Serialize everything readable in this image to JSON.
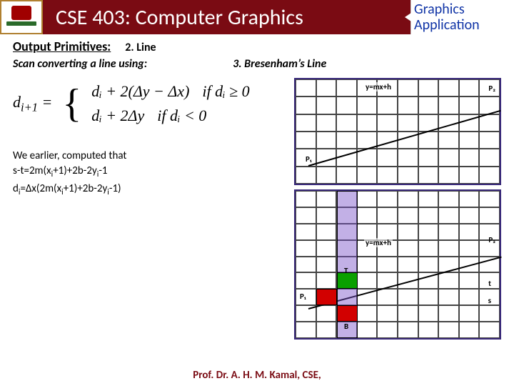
{
  "header": {
    "course": "CSE 403: Computer Graphics",
    "corner_line1": "Graphics",
    "corner_line2": "Application"
  },
  "topline": {
    "label": "Output Primitives:",
    "sub": "2. Line"
  },
  "scanline": {
    "scan": "Scan converting a line using:",
    "algo": "3. Bresenham’s Line"
  },
  "formula": {
    "lhs_d": "d",
    "lhs_sub": "i+1",
    "lhs_eq": " = ",
    "row1_expr": "dᵢ + 2(Δy − Δx)",
    "row1_cond": "if dᵢ ≥ 0",
    "row2_expr": "dᵢ + 2Δy",
    "row2_cond": "if dᵢ < 0"
  },
  "computed": {
    "lead": "We earlier, computed that",
    "line1_pre": "s-t=2m(x",
    "line1_mid": "+1)+2b-2y",
    "line1_post": "-1",
    "line2_d": "d",
    "line2_eq": "=Δx(2m(x",
    "line2_mid": "+1)+2b-2y",
    "line2_post": "-1)"
  },
  "diagram": {
    "eqn": "y=mx+h",
    "p1": "P₁",
    "p2": "P₂",
    "t": "T",
    "b": "B",
    "t_lab": "t",
    "s_lab": "s"
  },
  "footer": "Prof. Dr. A. H. M. Kamal, CSE,"
}
